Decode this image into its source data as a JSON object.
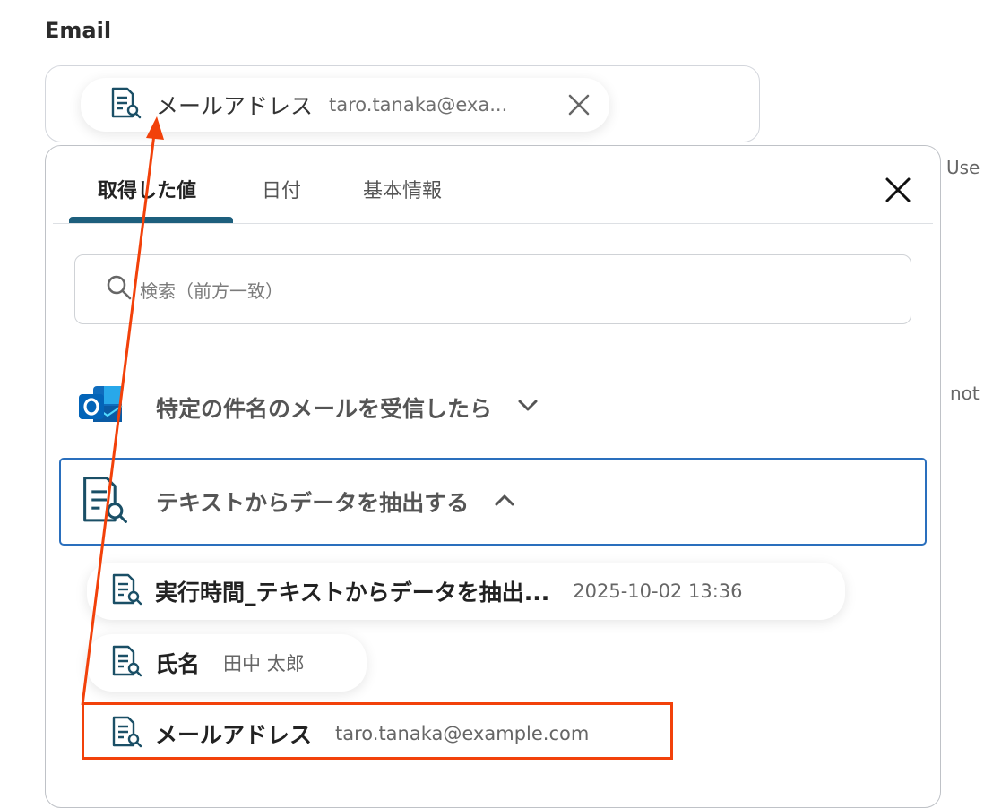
{
  "field": {
    "label": "Email",
    "selected": {
      "label": "メールアドレス",
      "value": "taro.tanaka@exa..."
    }
  },
  "side_texts": [
    "Use",
    "not"
  ],
  "panel": {
    "tabs": [
      "取得した値",
      "日付",
      "基本情報"
    ],
    "active_tab": "取得した値",
    "search_placeholder": "検索（前方一致）",
    "groups": [
      {
        "title": "特定の件名のメールを受信したら",
        "expanded": false,
        "icon": "outlook-icon"
      },
      {
        "title": "テキストからデータを抽出する",
        "expanded": true,
        "icon": "document-search-icon"
      }
    ],
    "items": [
      {
        "label": "実行時間_テキストからデータを抽出...",
        "value": "2025-10-02 13:36"
      },
      {
        "label": "氏名",
        "value": "田中 太郎"
      },
      {
        "label": "メールアドレス",
        "value": "taro.tanaka@example.com"
      }
    ]
  },
  "colors": {
    "accent": "#1d5f7d",
    "selection_border": "#2a6fbd",
    "annotation": "#f2410a",
    "icon": "#1a4f66"
  }
}
